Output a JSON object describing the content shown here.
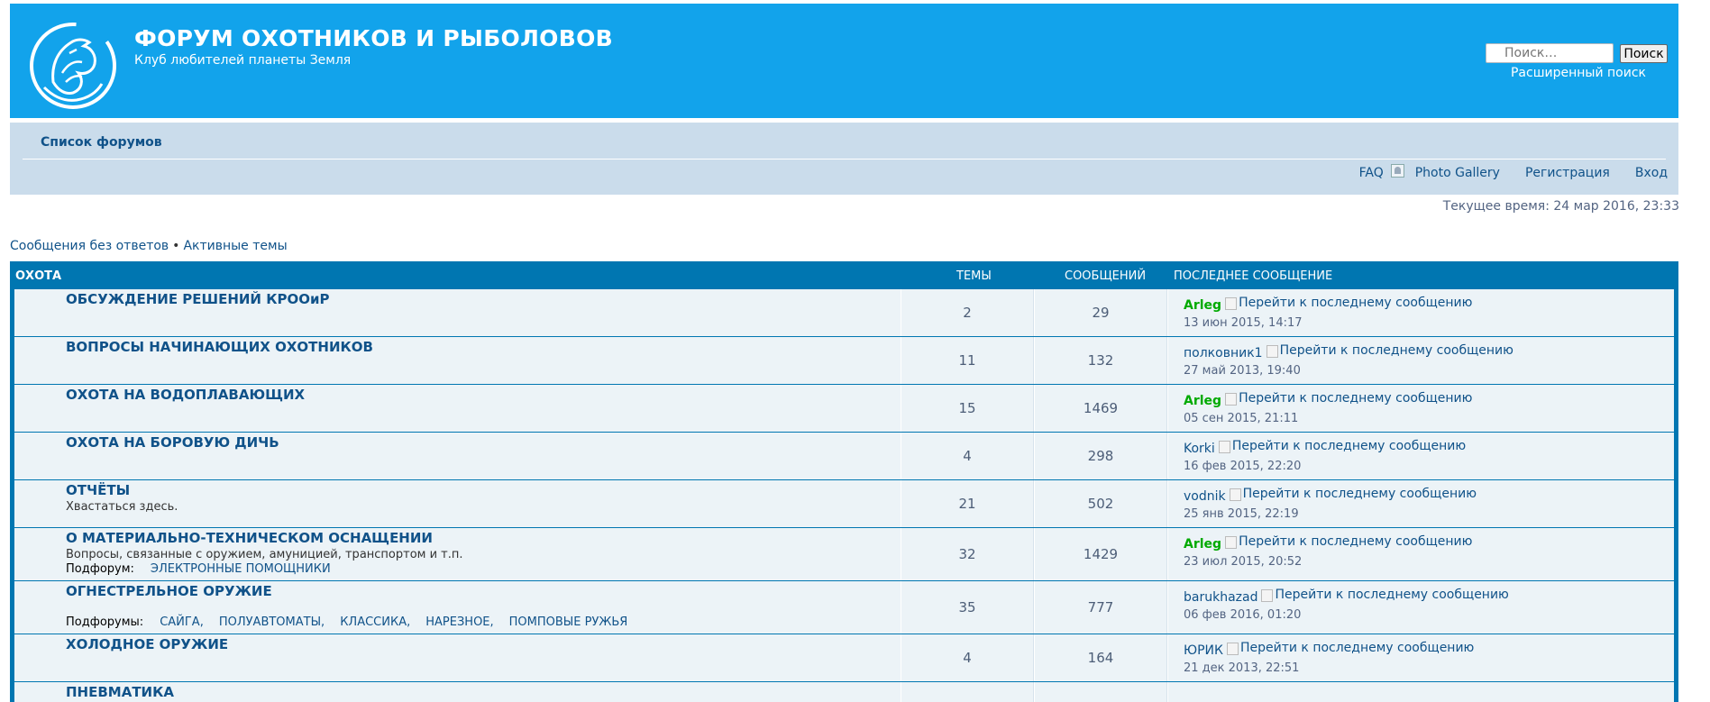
{
  "header": {
    "title": "ФОРУМ ОХОТНИКОВ И РЫБОЛОВОВ",
    "description": "Клуб любителей планеты Земля",
    "search_placeholder": "Поиск…",
    "search_button": "Поиск",
    "advanced_search": "Расширенный поиск"
  },
  "navbar": {
    "forum_index": "Список форумов",
    "faq": "FAQ",
    "photo_gallery": "Photo Gallery",
    "register": "Регистрация",
    "login": "Вход"
  },
  "current_time": "Текущее время: 24 мар 2016, 23:33",
  "quick_links": {
    "unanswered": "Сообщения без ответов",
    "separator": "•",
    "active": "Активные темы"
  },
  "category": {
    "name": "ОХОТА",
    "col_topics": "ТЕМЫ",
    "col_posts": "СООБЩЕНИЙ",
    "col_last": "ПОСЛЕДНЕЕ СООБЩЕНИЕ"
  },
  "goto_last_alt": "Перейти к последнему сообщению",
  "forums": [
    {
      "name": "ОБСУЖДЕНИЕ РЕШЕНИЙ КРООиР",
      "topics": "2",
      "posts": "29",
      "last_author": "Arleg",
      "author_color": "green",
      "last_time": "13 июн 2015, 14:17"
    },
    {
      "name": "ВОПРОСЫ НАЧИНАЮЩИХ ОХОТНИКОВ",
      "topics": "11",
      "posts": "132",
      "last_author": "полковник1",
      "author_color": "blue",
      "last_time": "27 май 2013, 19:40"
    },
    {
      "name": "ОХОТА НА ВОДОПЛАВАЮЩИХ",
      "topics": "15",
      "posts": "1469",
      "last_author": "Arleg",
      "author_color": "green",
      "last_time": "05 сен 2015, 21:11"
    },
    {
      "name": "ОХОТА НА БОРОВУЮ ДИЧЬ",
      "topics": "4",
      "posts": "298",
      "last_author": "Korki",
      "author_color": "blue",
      "last_time": "16 фев 2015, 22:20"
    },
    {
      "name": "ОТЧЁТЫ",
      "description": "Хвастаться здесь.",
      "topics": "21",
      "posts": "502",
      "last_author": "vodnik",
      "author_color": "blue",
      "last_time": "25 янв 2015, 22:19"
    },
    {
      "name": "О МАТЕРИАЛЬНО-ТЕХНИЧЕСКОМ ОСНАЩЕНИИ",
      "description": "Вопросы, связанные с оружием, амуницией, транспортом и т.п.",
      "subforum_label": "Подфорум:",
      "subforums": [
        "ЭЛЕКТРОННЫЕ ПОМОЩНИКИ"
      ],
      "topics": "32",
      "posts": "1429",
      "last_author": "Arleg",
      "author_color": "green",
      "last_time": "23 июл 2015, 20:52"
    },
    {
      "name": "ОГНЕСТРЕЛЬНОЕ ОРУЖИЕ",
      "subforum_label": "Подфорумы:",
      "subforums": [
        "САЙГА,",
        "ПОЛУАВТОМАТЫ,",
        "КЛАССИКА,",
        "НАРЕЗНОЕ,",
        "ПОМПОВЫЕ РУЖЬЯ"
      ],
      "topics": "35",
      "posts": "777",
      "last_author": "barukhazad",
      "author_color": "blue",
      "last_time": "06 фев 2016, 01:20"
    },
    {
      "name": "ХОЛОДНОЕ ОРУЖИЕ",
      "topics": "4",
      "posts": "164",
      "last_author": "ЮРИК",
      "author_color": "blue",
      "last_time": "21 дек 2013, 22:51"
    },
    {
      "name": "ПНЕВМАТИКА",
      "topics": "",
      "posts": "",
      "last_author": "",
      "author_color": "blue",
      "last_time": ""
    }
  ]
}
